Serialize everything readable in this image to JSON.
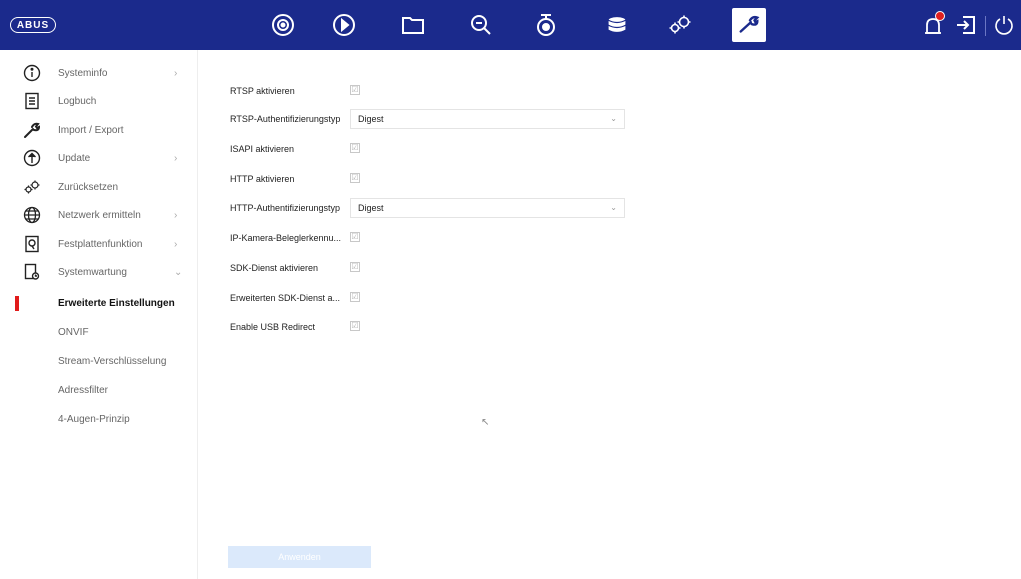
{
  "topbar": {
    "logo_text": "ABUS",
    "nav_icons": [
      "camera-icon",
      "play-icon",
      "folder-icon",
      "search-icon",
      "ptz-camera-icon",
      "storage-icon",
      "gears-icon",
      "wrench-icon"
    ],
    "active_nav": "wrench-icon",
    "right_icons": [
      "alarm-icon",
      "logout-icon",
      "power-icon"
    ],
    "bar_color": "#1b2a8c"
  },
  "sidebar": {
    "items": [
      {
        "label": "Systeminfo",
        "icon": "info-icon",
        "chevron": "›"
      },
      {
        "label": "Logbuch",
        "icon": "log-icon",
        "chevron": ""
      },
      {
        "label": "Import / Export",
        "icon": "wrench-icon",
        "chevron": ""
      },
      {
        "label": "Update",
        "icon": "update-icon",
        "chevron": "›"
      },
      {
        "label": "Zurücksetzen",
        "icon": "reset-gears-icon",
        "chevron": ""
      },
      {
        "label": "Netzwerk ermitteln",
        "icon": "globe-icon",
        "chevron": "›"
      },
      {
        "label": "Festplattenfunktion",
        "icon": "hdd-icon",
        "chevron": "›"
      },
      {
        "label": "Systemwartung",
        "icon": "maintenance-icon",
        "chevron": "⌄"
      }
    ],
    "sub_items": [
      {
        "label": "Erweiterte Einstellungen",
        "active": true
      },
      {
        "label": "ONVIF",
        "active": false
      },
      {
        "label": "Stream-Verschlüsselung",
        "active": false
      },
      {
        "label": "Adressfilter",
        "active": false
      },
      {
        "label": "4-Augen-Prinzip",
        "active": false
      }
    ],
    "active_marker_color": "#e11b1b"
  },
  "settings": {
    "rtsp_enable": {
      "label": "RTSP aktivieren",
      "checked": "☑"
    },
    "rtsp_auth": {
      "label": "RTSP-Authentifizierungstyp",
      "value": "Digest",
      "arrow": "⌄"
    },
    "isapi_enable": {
      "label": "ISAPI aktivieren",
      "checked": "☑"
    },
    "http_enable": {
      "label": "HTTP aktivieren",
      "checked": "☑"
    },
    "http_auth": {
      "label": "HTTP-Authentifizierungstyp",
      "value": "Digest",
      "arrow": "⌄"
    },
    "ip_camera_notify": {
      "label": "IP-Kamera-Beleglerkennu...",
      "checked": "☑"
    },
    "sdk_enable": {
      "label": "SDK-Dienst aktivieren",
      "checked": "☑"
    },
    "sdk_ext_enable": {
      "label": "Erweiterten SDK-Dienst a...",
      "checked": "☑"
    },
    "usb_redirect": {
      "label": "Enable USB Redirect",
      "checked": "☑"
    }
  },
  "footer": {
    "apply_label": "Anwenden"
  }
}
